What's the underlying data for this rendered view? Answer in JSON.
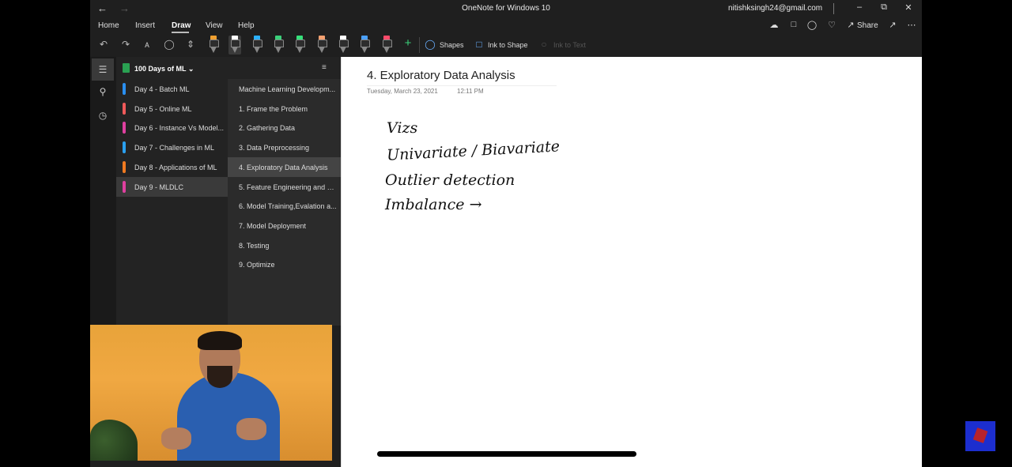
{
  "window": {
    "title": "OneNote for Windows 10",
    "user": "nitishksingh24@gmail.com",
    "back_icon": "arrow-left",
    "forward_icon": "arrow-right",
    "controls": [
      "minimize",
      "restore",
      "close"
    ]
  },
  "menu": {
    "tabs": [
      "Home",
      "Insert",
      "Draw",
      "View",
      "Help"
    ],
    "active_tab": "Draw",
    "share_label": "Share"
  },
  "toolbar": {
    "shapes_label": "Shapes",
    "ink_to_shape_label": "Ink to Shape",
    "ink_to_text_label": "Ink to Text",
    "pen_colors": [
      "#f0a030",
      "#ffffff",
      "#2ab0ff",
      "#3ad07a",
      "#36e07a",
      "#f4a070",
      "#ffffff",
      "#4aa0ff",
      "#ff4a6a"
    ]
  },
  "notebook": {
    "name": "100 Days of ML"
  },
  "sections": [
    {
      "label": "Day 4 - Batch ML",
      "color": "#2a8ff0"
    },
    {
      "label": "Day 5 - Online ML",
      "color": "#f05a5a"
    },
    {
      "label": "Day 6 - Instance Vs Model...",
      "color": "#e040a0"
    },
    {
      "label": "Day 7 - Challenges in ML",
      "color": "#2aa0f0"
    },
    {
      "label": "Day 8 - Applications of ML",
      "color": "#f07a20"
    },
    {
      "label": "Day 9 - MLDLC",
      "color": "#e040a0"
    }
  ],
  "active_section": 5,
  "pages": [
    "Machine Learning Developm...",
    "1. Frame the Problem",
    "2. Gathering Data",
    "3. Data Preprocessing",
    "4. Exploratory Data Analysis",
    "5. Feature Engineering and S...",
    "6. Model Training,Evalation a...",
    "7. Model Deployment",
    "8. Testing",
    "9. Optimize"
  ],
  "active_page": 4,
  "page": {
    "title": "4. Exploratory Data Analysis",
    "date": "Tuesday, March 23, 2021",
    "time": "12:11 PM",
    "ink_lines": [
      "Vizs",
      "Univariate / Biavariate",
      "Outlier detection",
      "Imbalance →"
    ]
  }
}
